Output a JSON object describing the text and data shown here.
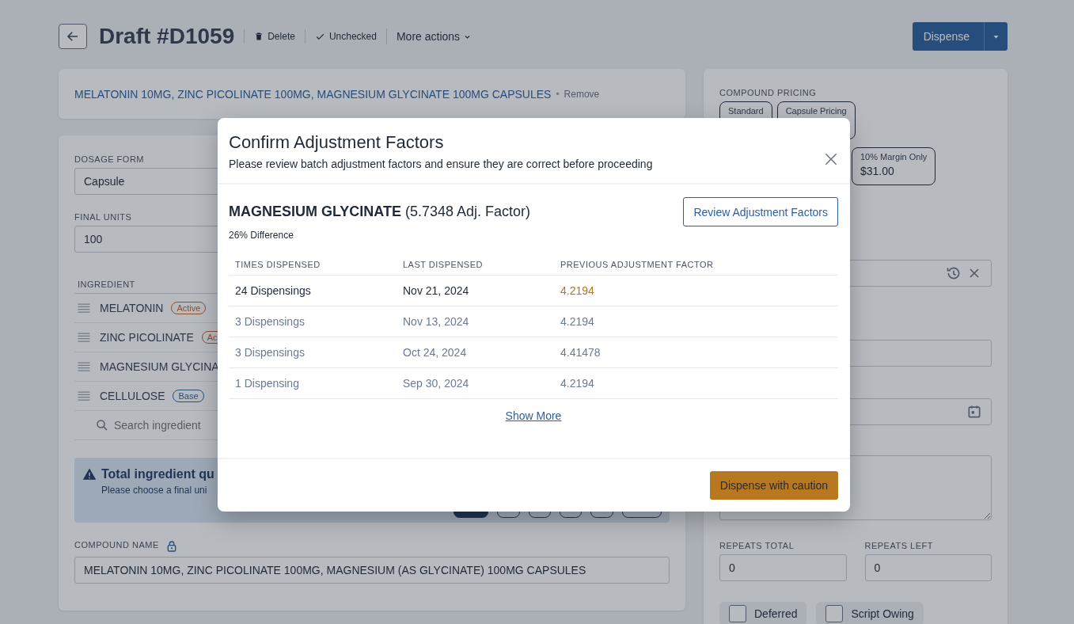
{
  "header": {
    "title": "Draft #D1059",
    "actions": [
      {
        "kind": "delete",
        "label": "Delete"
      },
      {
        "kind": "check",
        "label": "Unchecked"
      },
      {
        "kind": "menu",
        "label": "More actions"
      }
    ],
    "primary_button": "Dispense"
  },
  "product_card": {
    "title": "MELATONIN 10MG, ZINC PICOLINATE 100MG, MAGNESIUM GLYCINATE 100MG CAPSULES",
    "separator": "•",
    "action": "Remove"
  },
  "form": {
    "dosage_form": {
      "label": "DOSAGE FORM",
      "value": "Capsule"
    },
    "final_units": {
      "label": "FINAL UNITS",
      "value": "100"
    },
    "ingredients": {
      "header": "INGREDIENT",
      "rows": [
        {
          "name": "MELATONIN",
          "badge": {
            "label": "Active",
            "kind": "active"
          }
        },
        {
          "name": "ZINC PICOLINATE",
          "badge": {
            "label": "Ac",
            "kind": "active"
          }
        },
        {
          "name": "MAGNESIUM GLYCINA"
        },
        {
          "name": "CELLULOSE",
          "badge": {
            "label": "Base",
            "kind": "base"
          }
        }
      ],
      "search_placeholder": "Search ingredient"
    },
    "alert": {
      "title": "Total ingredient qu",
      "text": "Please choose a final uni",
      "unit_options": [
        {
          "selected": true
        },
        {
          "selected": false
        },
        {
          "selected": false
        },
        {
          "selected": false
        },
        {
          "selected": false
        },
        {
          "selected": false
        }
      ]
    },
    "compound_name": {
      "label": "COMPOUND NAME",
      "value": "MELATONIN 10MG, ZINC PICOLINATE 100MG, MAGNESIUM (AS GLYCINATE) 100MG CAPSULES"
    }
  },
  "pricing": {
    "label": "COMPOUND PRICING",
    "options": [
      {
        "label": "Standard"
      },
      {
        "label": "Capsule Pricing"
      },
      {
        "label": "10% Margin Only",
        "price": "$31.00"
      }
    ]
  },
  "repeats": [
    {
      "label": "REPEATS TOTAL",
      "value": "0"
    },
    {
      "label": "REPEATS LEFT",
      "value": "0"
    }
  ],
  "checkboxes": [
    {
      "label": "Deferred",
      "checked": false
    },
    {
      "label": "Script Owing",
      "checked": false
    }
  ],
  "modal": {
    "title": "Confirm Adjustment Factors",
    "subtitle": "Please review batch adjustment factors and ensure they are correct before proceeding",
    "ingredient": {
      "name": "MAGNESIUM GLYCINATE",
      "factor": "(5.7348 Adj. Factor)",
      "difference": "26% Difference"
    },
    "review_button": "Review Adjustment Factors",
    "columns": [
      "TIMES DISPENSED",
      "LAST DISPENSED",
      "PREVIOUS ADJUSTMENT FACTOR"
    ],
    "rows": [
      {
        "times": "24 Dispensings",
        "date": "Nov 21, 2024",
        "factor": "4.2194",
        "emphasized": true
      },
      {
        "times": "3 Dispensings",
        "date": "Nov 13, 2024",
        "factor": "4.2194",
        "emphasized": false
      },
      {
        "times": "3 Dispensings",
        "date": "Oct 24, 2024",
        "factor": "4.41478",
        "emphasized": false
      },
      {
        "times": "1 Dispensing",
        "date": "Sep 30, 2024",
        "factor": "4.2194",
        "emphasized": false
      }
    ],
    "show_more": "Show More",
    "confirm_button": "Dispense with caution"
  }
}
